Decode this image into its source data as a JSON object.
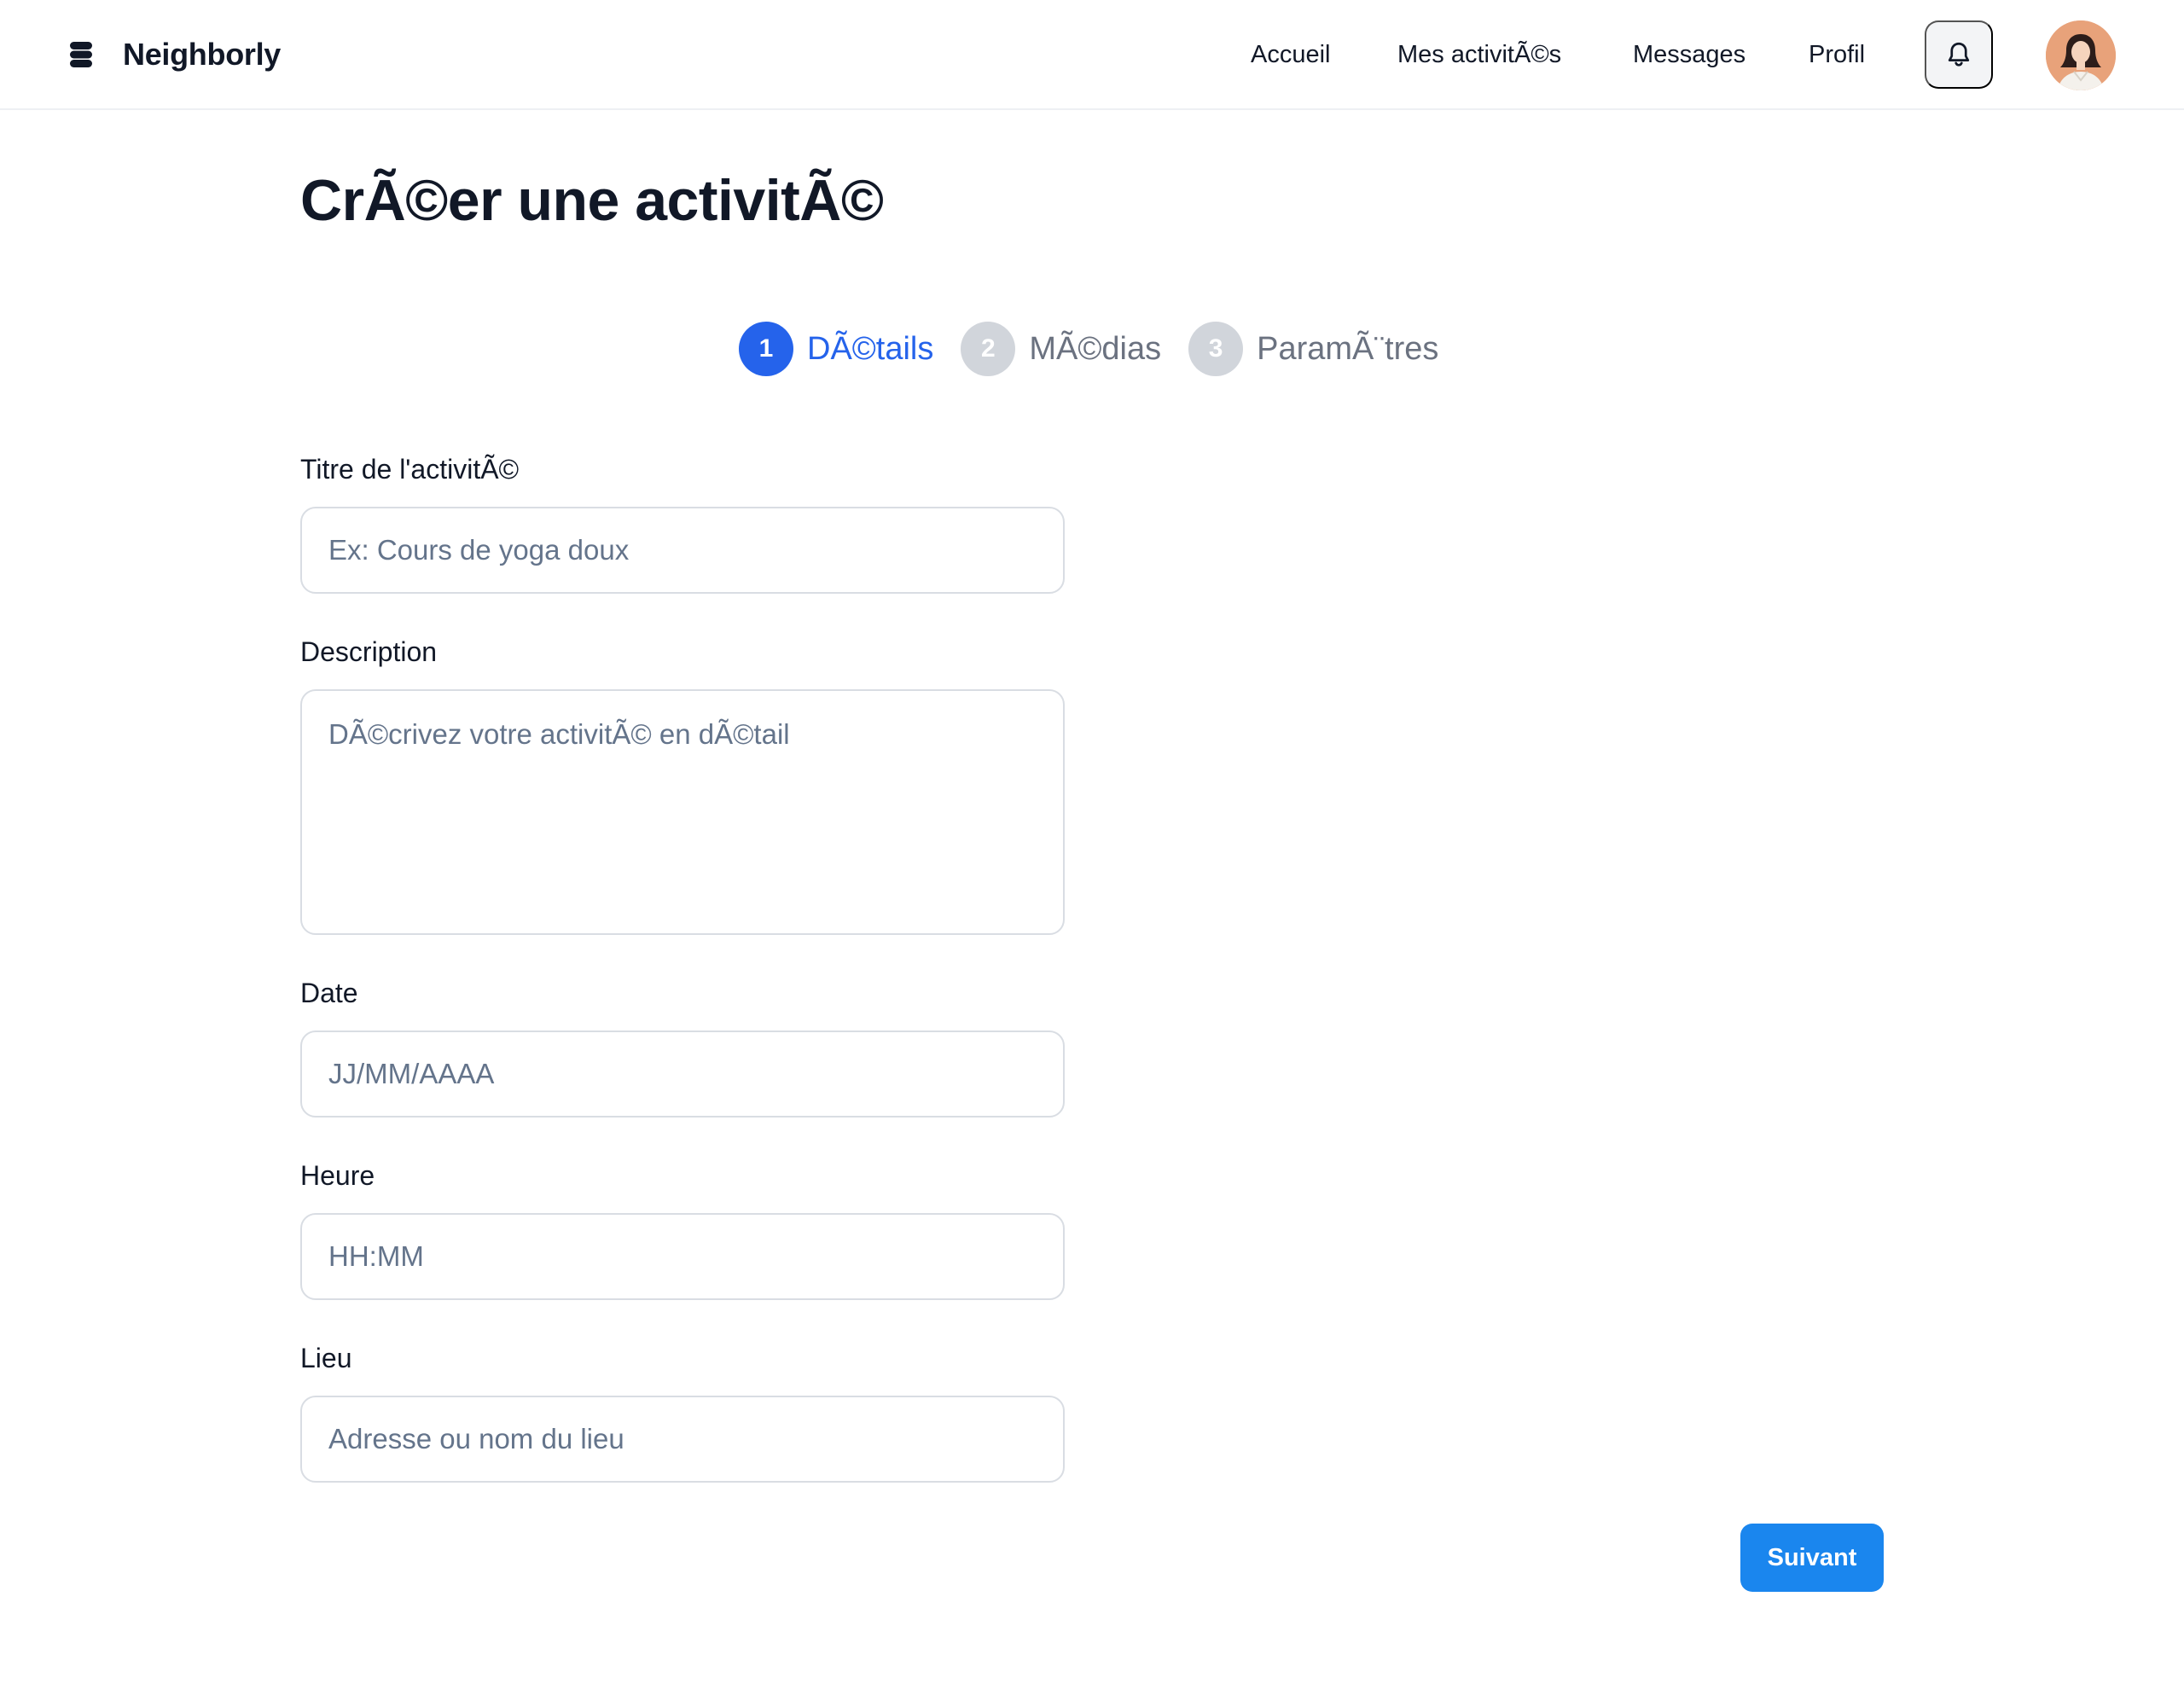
{
  "header": {
    "brand": "Neighborly",
    "nav": [
      "Accueil",
      "Mes activitÃ©s",
      "Messages",
      "Profil"
    ]
  },
  "page": {
    "title": "CrÃ©er une activitÃ©"
  },
  "steps": [
    {
      "number": "1",
      "label": "DÃ©tails",
      "active": true
    },
    {
      "number": "2",
      "label": "MÃ©dias",
      "active": false
    },
    {
      "number": "3",
      "label": "ParamÃ¨tres",
      "active": false
    }
  ],
  "form": {
    "title": {
      "label": "Titre de l'activitÃ©",
      "placeholder": "Ex: Cours de yoga doux",
      "value": ""
    },
    "description": {
      "label": "Description",
      "placeholder": "DÃ©crivez votre activitÃ© en dÃ©tail",
      "value": ""
    },
    "date": {
      "label": "Date",
      "placeholder": "JJ/MM/AAAA",
      "value": ""
    },
    "time": {
      "label": "Heure",
      "placeholder": "HH:MM",
      "value": ""
    },
    "location": {
      "label": "Lieu",
      "placeholder": "Adresse ou nom du lieu",
      "value": ""
    }
  },
  "actions": {
    "next": "Suivant"
  },
  "colors": {
    "accent": "#2563eb",
    "button": "#1a86ee",
    "inactive_step": "#d1d5db"
  },
  "icons": {
    "logo": "stacked-layers-icon",
    "notifications": "bell-icon",
    "avatar": "user-avatar"
  }
}
